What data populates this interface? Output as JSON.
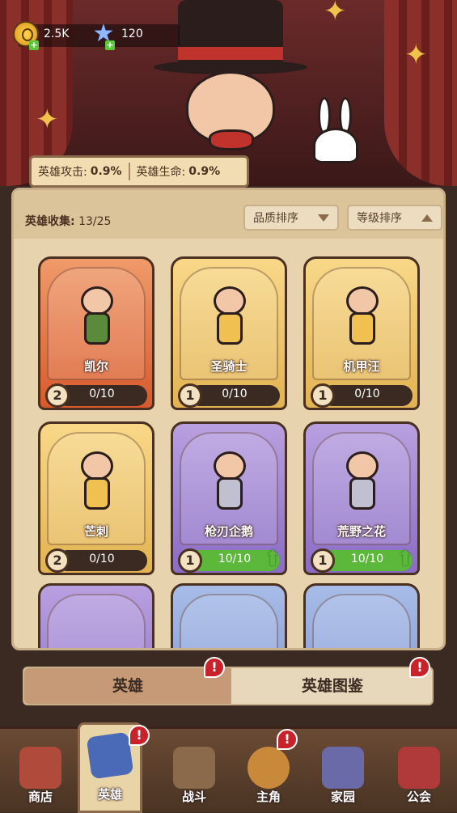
{
  "currency": {
    "coins": "2.5K",
    "gems": "120"
  },
  "buffs": {
    "attack_label": "英雄攻击:",
    "attack_value": "0.9%",
    "hp_label": "英雄生命:",
    "hp_value": "0.9%"
  },
  "collection": {
    "label": "英雄收集:",
    "value": "13/25",
    "sort_quality": "品质排序",
    "sort_level": "等级排序"
  },
  "heroes": [
    {
      "name": "凯尔",
      "level": "2",
      "progress": "0/10",
      "rarity": "orange",
      "upgradable": false
    },
    {
      "name": "圣骑士",
      "level": "1",
      "progress": "0/10",
      "rarity": "gold",
      "upgradable": false
    },
    {
      "name": "机甲汪",
      "level": "1",
      "progress": "0/10",
      "rarity": "gold",
      "upgradable": false
    },
    {
      "name": "芒刺",
      "level": "2",
      "progress": "0/10",
      "rarity": "gold",
      "upgradable": false
    },
    {
      "name": "枪刃企鹅",
      "level": "1",
      "progress": "10/10",
      "rarity": "purple",
      "upgradable": true
    },
    {
      "name": "荒野之花",
      "level": "1",
      "progress": "10/10",
      "rarity": "purple",
      "upgradable": true
    }
  ],
  "tabs": {
    "heroes": "英雄",
    "codex": "英雄图鉴"
  },
  "nav": {
    "shop": "商店",
    "heroes": "英雄",
    "battle": "战斗",
    "protagonist": "主角",
    "home": "家园",
    "guild": "公会"
  },
  "colors": {
    "panel": "#e7d3ae",
    "accent_green": "#5bb83a",
    "alert_red": "#c8232b"
  }
}
